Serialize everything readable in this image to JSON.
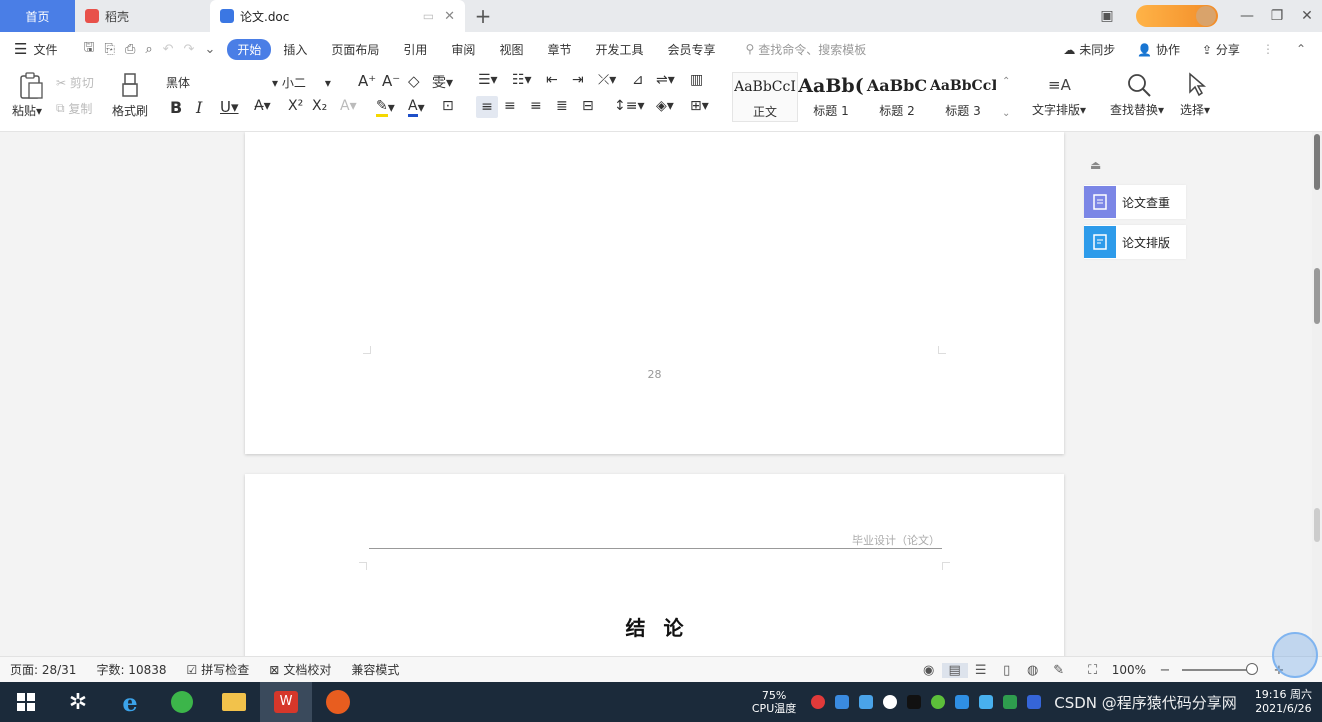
{
  "tabs": {
    "home": "首页",
    "daoke": "稻壳",
    "doc": "论文.doc"
  },
  "menu": {
    "file": "文件",
    "tabs": [
      "开始",
      "插入",
      "页面布局",
      "引用",
      "审阅",
      "视图",
      "章节",
      "开发工具",
      "会员专享"
    ],
    "search_placeholder": "查找命令、搜索模板",
    "sync": "未同步",
    "collab": "协作",
    "share": "分享"
  },
  "ribbon": {
    "paste": "粘贴",
    "cut": "剪切",
    "copy": "复制",
    "format_painter": "格式刷",
    "font_name": "黑体",
    "font_size": "小二",
    "styles": [
      {
        "sample": "AaBbCcI",
        "name": "正文"
      },
      {
        "sample": "AaBb(",
        "name": "标题 1"
      },
      {
        "sample": "AaBbC",
        "name": "标题 2"
      },
      {
        "sample": "AaBbCcI",
        "name": "标题 3"
      }
    ],
    "text_layout": "文字排版",
    "find_replace": "查找替换",
    "select": "选择"
  },
  "document": {
    "page_number": "28",
    "header_text": "毕业设计（论文）",
    "conclusion_title": "结论"
  },
  "sidepanel": {
    "check": "论文查重",
    "layout": "论文排版"
  },
  "status": {
    "page": "页面: 28/31",
    "words": "字数: 10838",
    "spellcheck": "拼写检查",
    "doccheck": "文档校对",
    "compat": "兼容模式",
    "zoom": "100%"
  },
  "taskbar": {
    "cpu_pct": "75%",
    "cpu_label": "CPU温度",
    "watermark": "CSDN @程序猿代码分享网",
    "time": "19:16 周六",
    "date": "2021/6/26"
  },
  "colors": {
    "accent": "#4a7ee6",
    "taskbar": "#1b2a3a",
    "wps_red": "#d6372a"
  }
}
